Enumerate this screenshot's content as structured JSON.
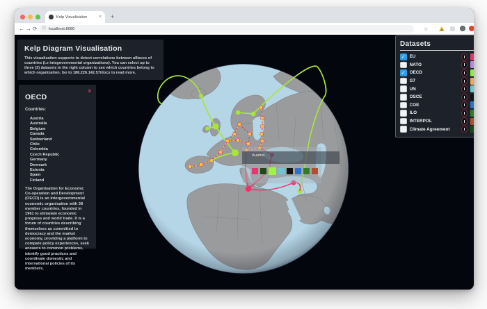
{
  "browser": {
    "tab_title": "Kelp Visualisation",
    "tab_close_glyph": "×",
    "new_tab_glyph": "+",
    "url": "localhost:8080",
    "icons": {
      "back": "←",
      "forward": "→",
      "reload": "⟳",
      "url_info": "ⓘ",
      "bookmark_star": "☆"
    }
  },
  "header_panel": {
    "title": "Kelp Diagram Visualisation",
    "description": "This visualization supports to detect correlations between alliaces of countries (i.e integovernmental organizations). You can select up to three (3) datasets in the right column to see which countries belong to which organization. Go to 188.226.142.57/docs to read more."
  },
  "oecd_panel": {
    "title": "OECD",
    "close_label": "x",
    "countries_label": "Countries:",
    "countries": [
      "Austria",
      "Australia",
      "Belgium",
      "Canada",
      "Switzerland",
      "Chile",
      "Colombia",
      "Czech Republic",
      "Germany",
      "Denmark",
      "Estonia",
      "Spain",
      "Finland"
    ],
    "description": "The Organisation for Economic Co-operation and Development (OECD) is an intergovernmental economic organisation with 38 member countries, founded in 1961 to stimulate economic progress and world trade. It is a forum of countries describing themselves as committed to democracy and the market economy, providing a platform to compare policy experiences, seek answers to common problems, identify good practices and coordinate domestic and international policies of its members."
  },
  "datasets_panel": {
    "title": "Datasets",
    "check_glyph": "✓",
    "items": [
      {
        "label": "EU",
        "checked": true,
        "color": "#e8356d"
      },
      {
        "label": "NATO",
        "checked": false,
        "color": "#b48ce0"
      },
      {
        "label": "OECD",
        "checked": true,
        "color": "#8df03c"
      },
      {
        "label": "G7",
        "checked": false,
        "color": "#f2a65a"
      },
      {
        "label": "UN",
        "checked": false,
        "color": "#6ec6d2"
      },
      {
        "label": "OSCE",
        "checked": false,
        "color": "#121212"
      },
      {
        "label": "COE",
        "checked": false,
        "color": "#2e72c8"
      },
      {
        "label": "ILO",
        "checked": false,
        "color": "#2f7d27"
      },
      {
        "label": "INTERPOL",
        "checked": false,
        "color": "#a85330"
      },
      {
        "label": "Climate Agreement",
        "checked": false,
        "color": "#1e4a1a"
      }
    ]
  },
  "tooltip": {
    "country": "Austria",
    "swatches": [
      {
        "color": "#e8356d"
      },
      {
        "color": "#1e4a1a"
      },
      {
        "color": "#9cf441",
        "highlight": true
      },
      {
        "color": "#6ec6d2"
      },
      {
        "color": "#121212"
      },
      {
        "color": "#2e72c8"
      },
      {
        "color": "#2f7d27"
      },
      {
        "color": "#b2502e"
      }
    ]
  },
  "theme": {
    "pagebg": "#04060e",
    "panelbg": "#1d222a",
    "tabstrip": "#dee1e6",
    "checkblue": "#2b9fe8",
    "inforing": "#7c2838",
    "eu": "#e8356d",
    "eunode": "#f0c840",
    "oecd": "#a8e636",
    "ocean": "#b5d6e7",
    "land": "#9a9b9d",
    "landborder": "#83858a"
  }
}
